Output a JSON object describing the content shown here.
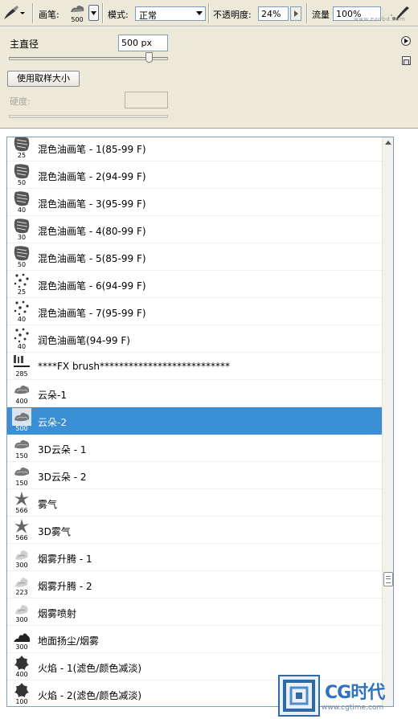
{
  "toolbar": {
    "brush_label": "画笔:",
    "brush_size": "500",
    "mode_label": "模式:",
    "mode_value": "正常",
    "opacity_label": "不透明度:",
    "opacity_value": "24%",
    "flow_label": "流量",
    "flow_value": "100%",
    "site_watermark": "www.eadbd.com"
  },
  "settings": {
    "master_diameter_label": "主直径",
    "master_diameter_value": "500 px",
    "master_diameter_slider_fraction": 0.88,
    "use_sample_size_button": "使用取样大小",
    "hardness_label": "硬度:"
  },
  "brush_list": {
    "selected_index": 10,
    "scroll_fraction": 0.78,
    "items": [
      {
        "size": "25",
        "name": "混色油画笔 - 1(85-99 F)",
        "icon": "oil-brush-icon"
      },
      {
        "size": "50",
        "name": "混色油画笔 - 2(94-99 F)",
        "icon": "oil-brush-icon"
      },
      {
        "size": "40",
        "name": "混色油画笔 - 3(95-99 F)",
        "icon": "oil-brush-icon"
      },
      {
        "size": "30",
        "name": "混色油画笔 - 4(80-99 F)",
        "icon": "oil-brush-icon"
      },
      {
        "size": "50",
        "name": "混色油画笔 - 5(85-99 F)",
        "icon": "oil-brush-icon"
      },
      {
        "size": "25",
        "name": "混色油画笔 - 6(94-99 F)",
        "icon": "dots-brush-icon"
      },
      {
        "size": "40",
        "name": "混色油画笔 - 7(95-99 F)",
        "icon": "dots-brush-icon"
      },
      {
        "size": "40",
        "name": "润色油画笔(94-99 F)",
        "icon": "dots-brush-icon"
      },
      {
        "size": "285",
        "name": "****FX brush***************************",
        "icon": "fx-brush-icon"
      },
      {
        "size": "400",
        "name": "云朵-1",
        "icon": "cloud-brush-icon"
      },
      {
        "size": "500",
        "name": "云朵-2",
        "icon": "cloud-brush-icon"
      },
      {
        "size": "150",
        "name": "3D云朵 - 1",
        "icon": "cloud-brush-icon"
      },
      {
        "size": "150",
        "name": "3D云朵 - 2",
        "icon": "cloud-brush-icon"
      },
      {
        "size": "566",
        "name": "雾气",
        "icon": "fog-brush-icon"
      },
      {
        "size": "566",
        "name": "3D雾气",
        "icon": "fog-brush-icon"
      },
      {
        "size": "300",
        "name": "烟雾升腾 - 1",
        "icon": "smoke-brush-icon"
      },
      {
        "size": "223",
        "name": "烟雾升腾 - 2",
        "icon": "smoke-brush-icon"
      },
      {
        "size": "300",
        "name": "烟雾喷射",
        "icon": "smoke-brush-icon"
      },
      {
        "size": "300",
        "name": "地面扬尘/烟雾",
        "icon": "dust-brush-icon"
      },
      {
        "size": "400",
        "name": "火焰 - 1(滤色/颜色减淡)",
        "icon": "fire-brush-icon"
      },
      {
        "size": "100",
        "name": "火焰 - 2(滤色/颜色减淡)",
        "icon": "fire-brush-icon"
      }
    ]
  },
  "logo": {
    "text": "CG时代",
    "url": "www.cgtime.com"
  }
}
